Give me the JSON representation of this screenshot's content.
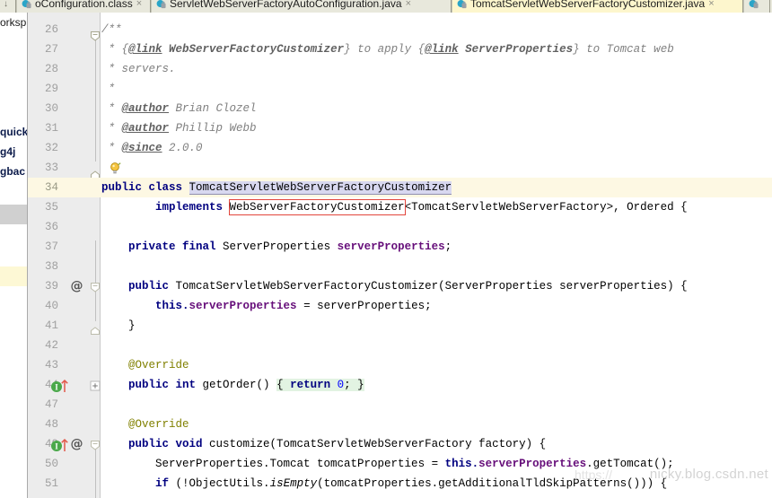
{
  "window": {
    "app": "IntelliJ IDEA Editor",
    "watermark": "nicky.blog.csdn.net",
    "watermark_prefix": "https://"
  },
  "tabbar": {
    "pin_glyph": "↓",
    "close_glyph": "×",
    "tabs": [
      {
        "label": "oConfiguration.class",
        "active": false,
        "icon": "java-class-icon",
        "truncated_left": true
      },
      {
        "label": "ServletWebServerFactoryAutoConfiguration.java",
        "active": false,
        "icon": "java-file-icon"
      },
      {
        "label": "TomcatServletWebServerFactoryCustomizer.java",
        "active": true,
        "icon": "java-file-icon"
      },
      {
        "label": "",
        "active": false,
        "icon": "java-file-icon"
      }
    ]
  },
  "left_panel": {
    "top_label": "orksp",
    "items": [
      {
        "label": "quick"
      },
      {
        "label": "g4j"
      },
      {
        "label": "gbac"
      }
    ]
  },
  "gutter": {
    "icons": {
      "at": "@",
      "implements_marker": "implements-method-icon",
      "fold_expand": "+",
      "fold_collapse": "−",
      "bulb": "intention-bulb-icon"
    }
  },
  "editor": {
    "highlighted_line": 34,
    "colors": {
      "keyword": "#000080",
      "comment": "#808080",
      "annotation": "#808000",
      "field": "#660e7a",
      "number": "#0000ff",
      "identifier_highlight_bg": "#d8d8f0",
      "redbox_border": "#e2453c",
      "folded_bg": "#e2f3e2",
      "current_line_bg": "#fdf8e3",
      "gutter_bg": "#ececec"
    },
    "lines": [
      {
        "n": 26,
        "indent": 0,
        "text": "/**",
        "kind": "comment"
      },
      {
        "n": 27,
        "indent": 0,
        "text": " * {@link WebServerFactoryCustomizer} to apply {@link ServerProperties} to Tomcat web",
        "kind": "comment"
      },
      {
        "n": 28,
        "indent": 0,
        "text": " * servers.",
        "kind": "comment"
      },
      {
        "n": 29,
        "indent": 0,
        "text": " *",
        "kind": "comment"
      },
      {
        "n": 30,
        "indent": 0,
        "text": " * @author Brian Clozel",
        "kind": "comment"
      },
      {
        "n": 31,
        "indent": 0,
        "text": " * @author Phillip Webb",
        "kind": "comment"
      },
      {
        "n": 32,
        "indent": 0,
        "text": " * @since 2.0.0",
        "kind": "comment"
      },
      {
        "n": 33,
        "indent": 0,
        "text": " */",
        "kind": "comment"
      },
      {
        "n": 34,
        "indent": 0,
        "text": "public class TomcatServletWebServerFactoryCustomizer",
        "kind": "code"
      },
      {
        "n": 35,
        "indent": 0,
        "text": "        implements WebServerFactoryCustomizer<TomcatServletWebServerFactory>, Ordered {",
        "kind": "code"
      },
      {
        "n": 36,
        "indent": 0,
        "text": "",
        "kind": "blank"
      },
      {
        "n": 37,
        "indent": 0,
        "text": "    private final ServerProperties serverProperties;",
        "kind": "code"
      },
      {
        "n": 38,
        "indent": 0,
        "text": "",
        "kind": "blank"
      },
      {
        "n": 39,
        "indent": 0,
        "text": "    public TomcatServletWebServerFactoryCustomizer(ServerProperties serverProperties) {",
        "kind": "code"
      },
      {
        "n": 40,
        "indent": 0,
        "text": "        this.serverProperties = serverProperties;",
        "kind": "code"
      },
      {
        "n": 41,
        "indent": 0,
        "text": "    }",
        "kind": "code"
      },
      {
        "n": 42,
        "indent": 0,
        "text": "",
        "kind": "blank"
      },
      {
        "n": 43,
        "indent": 0,
        "text": "    @Override",
        "kind": "annotation"
      },
      {
        "n": 44,
        "indent": 0,
        "text": "    public int getOrder() { return 0; }",
        "kind": "code"
      },
      {
        "n": 47,
        "indent": 0,
        "text": "",
        "kind": "blank"
      },
      {
        "n": 48,
        "indent": 0,
        "text": "    @Override",
        "kind": "annotation"
      },
      {
        "n": 49,
        "indent": 0,
        "text": "    public void customize(TomcatServletWebServerFactory factory) {",
        "kind": "code"
      },
      {
        "n": 50,
        "indent": 0,
        "text": "        ServerProperties.Tomcat tomcatProperties = this.serverProperties.getTomcat();",
        "kind": "code"
      },
      {
        "n": 51,
        "indent": 0,
        "text": "        if (!ObjectUtils.isEmpty(tomcatProperties.getAdditionalTldSkipPatterns())) {",
        "kind": "code"
      }
    ]
  }
}
